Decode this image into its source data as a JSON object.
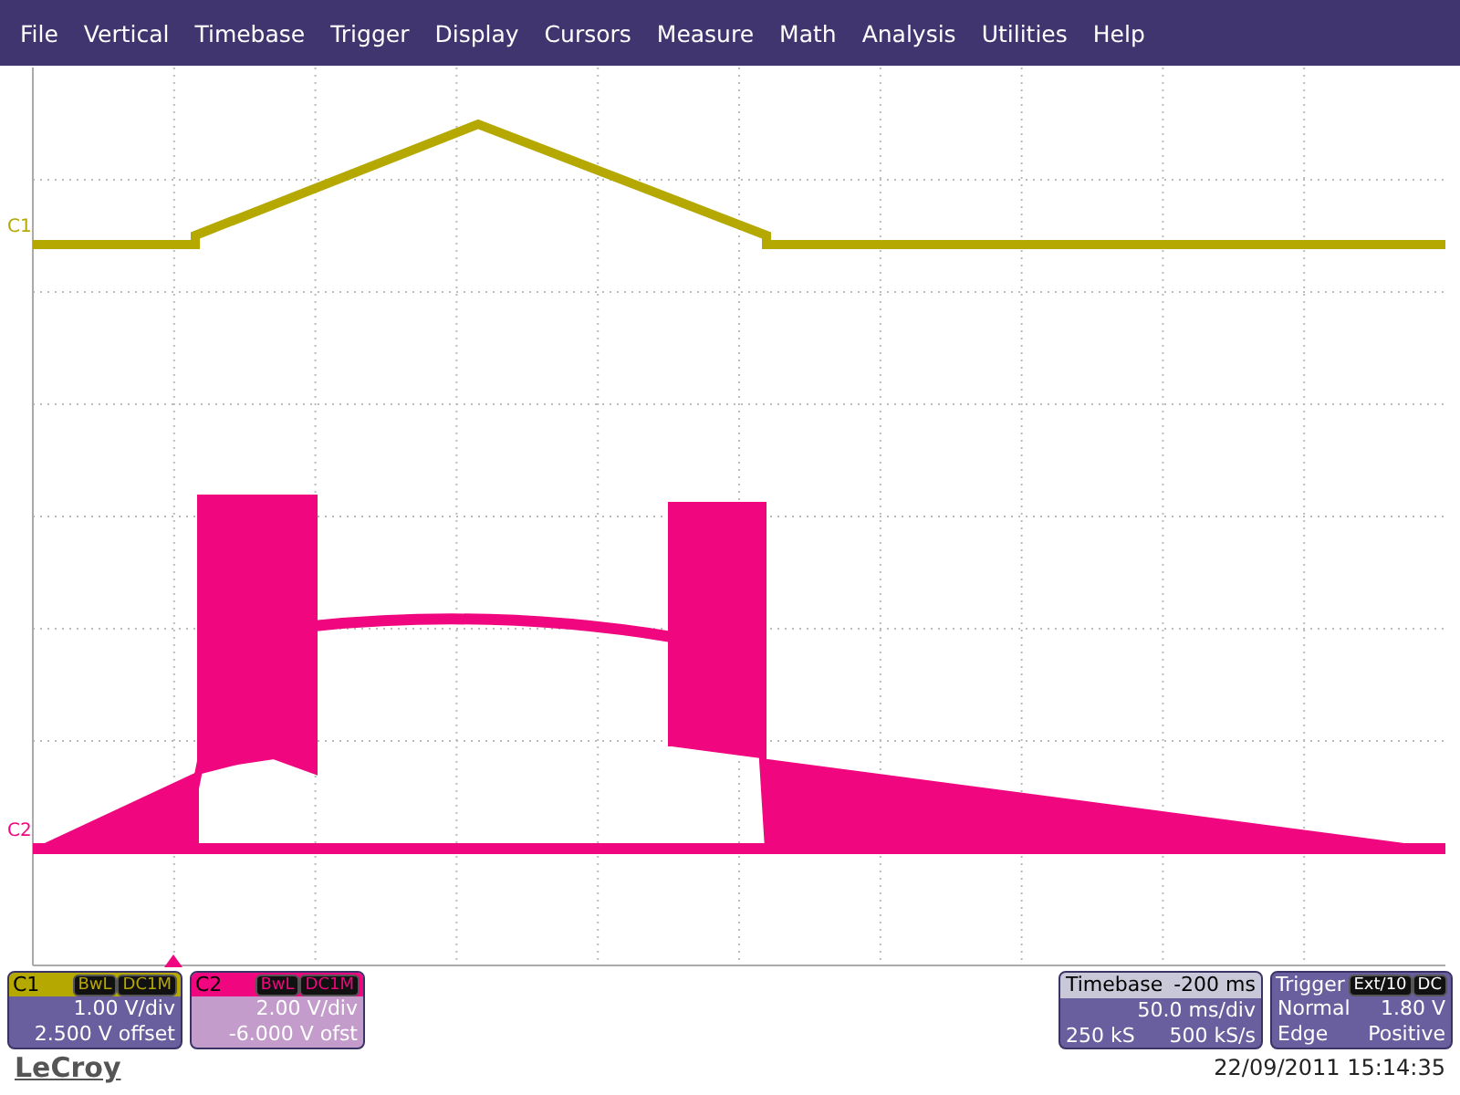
{
  "menu": [
    "File",
    "Vertical",
    "Timebase",
    "Trigger",
    "Display",
    "Cursors",
    "Measure",
    "Math",
    "Analysis",
    "Utilities",
    "Help"
  ],
  "traces": [
    {
      "label": "C1",
      "color": "#b5a800"
    },
    {
      "label": "C2",
      "color": "#f0067e"
    }
  ],
  "channels": [
    {
      "label": "C1",
      "color": "#b5a800",
      "selected": true,
      "tags": [
        "BwL",
        "DC1M"
      ],
      "scale": "1.00 V/div",
      "offset": "2.500 V offset"
    },
    {
      "label": "C2",
      "color": "#f0067e",
      "selected": false,
      "tags": [
        "BwL",
        "DC1M"
      ],
      "scale": "2.00 V/div",
      "offset": "-6.000 V ofst"
    }
  ],
  "timebase": {
    "title": "Timebase",
    "delay": "-200 ms",
    "scale": "50.0 ms/div",
    "samples": "250 kS",
    "rate": "500 kS/s"
  },
  "trigger": {
    "title": "Trigger",
    "tags": [
      "Ext/10",
      "DC"
    ],
    "mode": "Normal",
    "level": "1.80 V",
    "type": "Edge",
    "slope": "Positive"
  },
  "brand": "LeCroy",
  "timestamp": "22/09/2011 15:14:35"
}
